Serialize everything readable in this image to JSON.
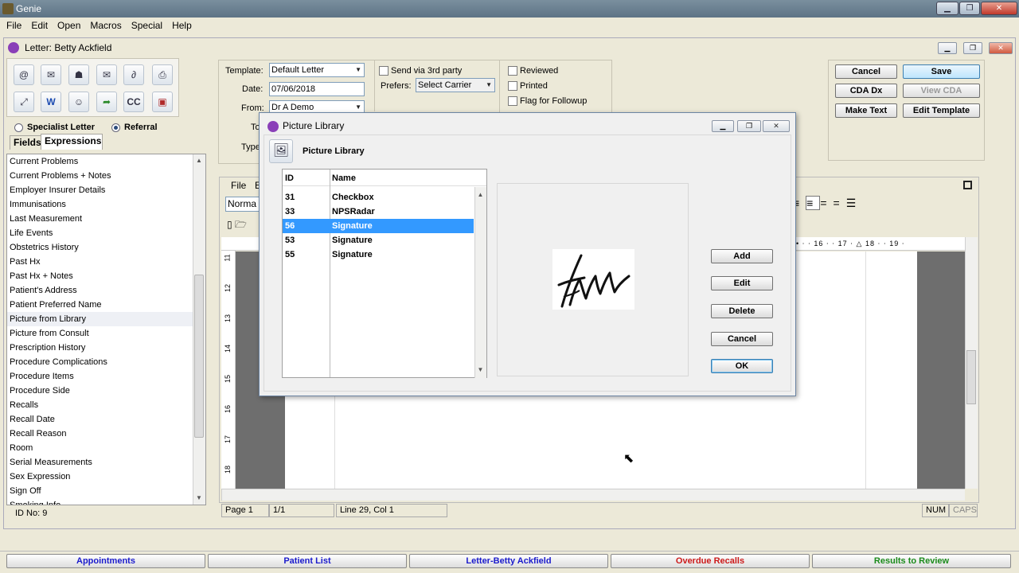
{
  "app": {
    "title": "Genie"
  },
  "menu": [
    "File",
    "Edit",
    "Open",
    "Macros",
    "Special",
    "Help"
  ],
  "document": {
    "title": "Letter: Betty Ackfield"
  },
  "left": {
    "radio_specialist": "Specialist Letter",
    "radio_referral": "Referral",
    "tab_fields": "Fields",
    "tab_expressions": "Expressions",
    "items": [
      "Current Problems",
      "Current Problems + Notes",
      "Employer Insurer Details",
      "Immunisations",
      "Last Measurement",
      "Life Events",
      "Obstetrics History",
      "Past Hx",
      "Past Hx + Notes",
      "Patient's Address",
      "Patient Preferred Name",
      "Picture from Library",
      "Picture from Consult",
      "Prescription History",
      "Procedure Complications",
      "Procedure Items",
      "Procedure Side",
      "Recalls",
      "Recall Date",
      "Recall Reason",
      "Room",
      "Serial Measurements",
      "Sex Expression",
      "Sign Off",
      "Smoking Info"
    ],
    "id_label": "ID No:  9"
  },
  "form": {
    "template_label": "Template:",
    "template_value": "Default Letter",
    "date_label": "Date:",
    "date_value": "07/06/2018",
    "from_label": "From:",
    "from_value": "Dr A Demo",
    "to_label": "To",
    "type_label": "Type",
    "send_3rd_party": "Send via 3rd party",
    "prefers_label": "Prefers:",
    "prefers_value": "Select Carrier",
    "reviewed": "Reviewed",
    "printed": "Printed",
    "flag_followup": "Flag for Followup"
  },
  "actions": {
    "cancel": "Cancel",
    "save": "Save",
    "cda_dx": "CDA Dx",
    "view_cda": "View CDA",
    "make_text": "Make Text",
    "edit_template": "Edit Template"
  },
  "editor": {
    "menu_file": "File",
    "menu_e": "E",
    "style_value": "Norma",
    "ruler_marks": [
      "16",
      "17",
      "18",
      "19"
    ],
    "vruler_marks": [
      "11",
      "12",
      "13",
      "14",
      "15",
      "16",
      "17",
      "18"
    ],
    "status_page": "Page 1",
    "status_pages": "1/1",
    "status_pos": "Line 29, Col 1",
    "status_num": "NUM",
    "status_caps": "CAPS"
  },
  "dialog": {
    "window_title": "Picture Library",
    "heading": "Picture Library",
    "col_id": "ID",
    "col_name": "Name",
    "rows": [
      {
        "id": "31",
        "name": "Checkbox"
      },
      {
        "id": "33",
        "name": "NPSRadar"
      },
      {
        "id": "56",
        "name": "Signature"
      },
      {
        "id": "53",
        "name": "Signature"
      },
      {
        "id": "55",
        "name": "Signature"
      }
    ],
    "selected_index": 2,
    "buttons": {
      "add": "Add",
      "edit": "Edit",
      "delete": "Delete",
      "cancel": "Cancel",
      "ok": "OK"
    }
  },
  "taskbar": [
    {
      "label": "Appointments",
      "color": "#1a1acc"
    },
    {
      "label": "Patient List",
      "color": "#1a1acc"
    },
    {
      "label": "Letter-Betty Ackfield",
      "color": "#1a1acc"
    },
    {
      "label": "Overdue Recalls",
      "color": "#cc1a1a"
    },
    {
      "label": "Results to Review",
      "color": "#1a8a1a"
    }
  ]
}
